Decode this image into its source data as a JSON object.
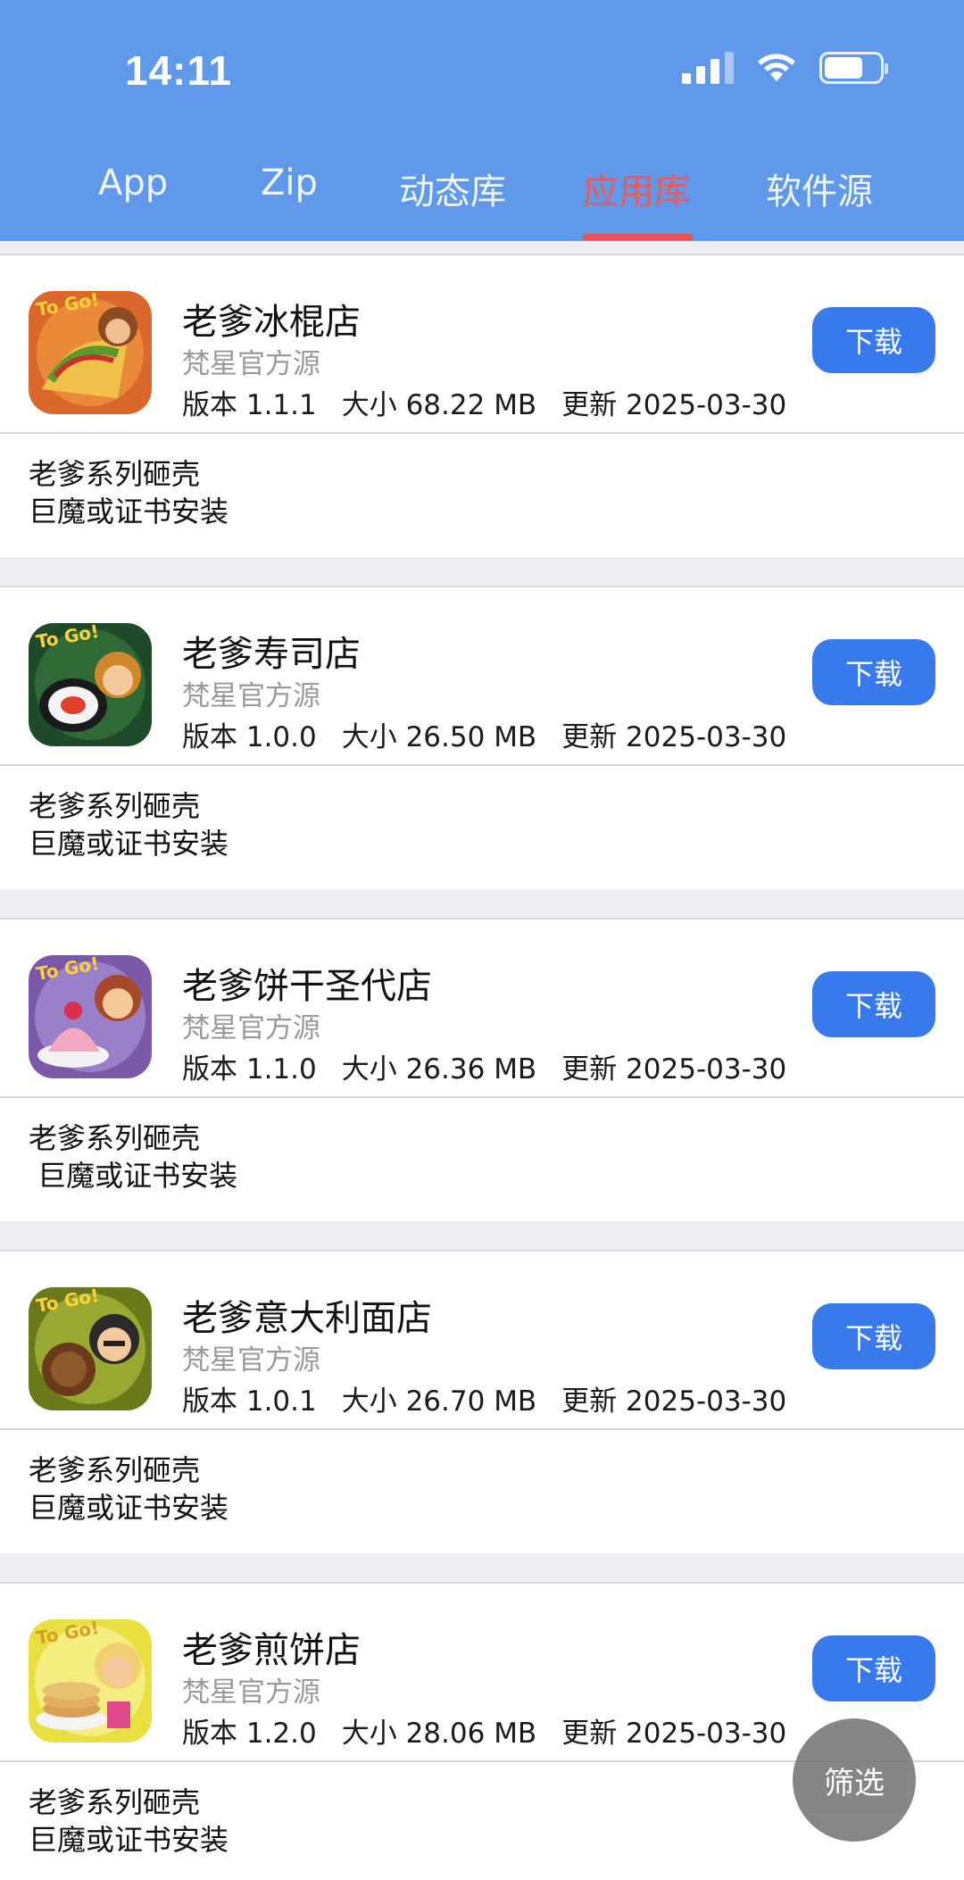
{
  "status_bar": {
    "time": "14:11"
  },
  "tabs": [
    {
      "label": "App",
      "active": false
    },
    {
      "label": "Zip",
      "active": false
    },
    {
      "label": "动态库",
      "active": false
    },
    {
      "label": "应用库",
      "active": true
    },
    {
      "label": "软件源",
      "active": false
    }
  ],
  "apps": [
    {
      "name": "老爹冰棍店",
      "source": "梵星官方源",
      "version": "版本 1.1.1",
      "size": "大小 68.22 MB",
      "updated": "更新 2025-03-30",
      "button": "下载",
      "description": "老爹系列砸壳\n巨魔或证书安装",
      "icon": "taco-game-icon"
    },
    {
      "name": "老爹寿司店",
      "source": "梵星官方源",
      "version": "版本 1.0.0",
      "size": "大小 26.50 MB",
      "updated": "更新 2025-03-30",
      "button": "下载",
      "description": "老爹系列砸壳\n巨魔或证书安装",
      "icon": "sushi-game-icon"
    },
    {
      "name": "老爹饼干圣代店",
      "source": "梵星官方源",
      "version": "版本 1.1.0",
      "size": "大小 26.36 MB",
      "updated": "更新 2025-03-30",
      "button": "下载",
      "description": "老爹系列砸壳\n 巨魔或证书安装",
      "icon": "sundae-game-icon"
    },
    {
      "name": "老爹意大利面店",
      "source": "梵星官方源",
      "version": "版本 1.0.1",
      "size": "大小 26.70 MB",
      "updated": "更新 2025-03-30",
      "button": "下载",
      "description": "老爹系列砸壳\n巨魔或证书安装",
      "icon": "pasta-game-icon"
    },
    {
      "name": "老爹煎饼店",
      "source": "梵星官方源",
      "version": "版本 1.2.0",
      "size": "大小 28.06 MB",
      "updated": "更新 2025-03-30",
      "button": "下载",
      "description": "老爹系列砸壳\n巨魔或证书安装",
      "icon": "pancake-game-icon"
    }
  ],
  "filter_button": "筛选",
  "colors": {
    "header": "#6098ea",
    "active_tab": "#ee5a5a",
    "button": "#3879ec",
    "fab": "#7f7f7f"
  }
}
